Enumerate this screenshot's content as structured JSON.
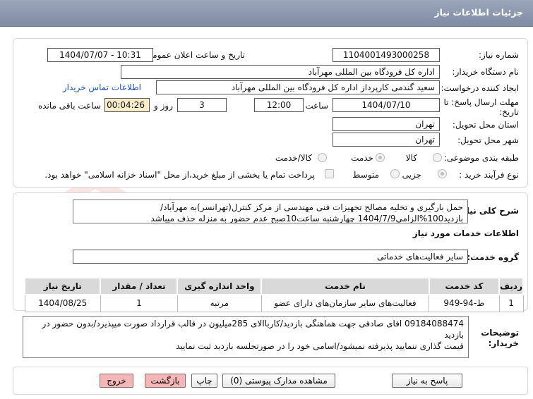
{
  "header": {
    "title": "جزئیات اطلاعات نیاز"
  },
  "form": {
    "need_number_label": "شماره نیاز:",
    "need_number": "1104001493000258",
    "announce_label": "تاریخ و ساعت اعلان عمومی:",
    "announce_value": "1404/07/07 - 10:31",
    "buyer_label": "نام دستگاه خریدار:",
    "buyer_value": "اداره کل فرودگاه بین المللی مهرآباد",
    "creator_label": "ایجاد کننده درخواست:",
    "creator_value": "سعید گندمی کارپرداز اداره کل فرودگاه بین المللی مهرآباد",
    "contact_link": "اطلاعات تماس خریدار",
    "deadline_label_1": "مهلت ارسال پاسخ: تا",
    "deadline_label_2": "تاریخ:",
    "deadline_date": "1404/07/10",
    "time_label": "ساعت",
    "deadline_time": "12:00",
    "days_value": "3",
    "days_label": "روز و",
    "timer_value": "00:04:26",
    "remaining_label": "ساعت باقی مانده",
    "province_label": "استان محل تحویل:",
    "province_value": "تهران",
    "city_label": "شهر محل تحویل:",
    "city_value": "تهران",
    "category_label": "طبقه بندی موضوعی:",
    "category_options": [
      "کالا",
      "خدمت",
      "کالا/خدمت"
    ],
    "process_label": "نوع فرآیند خرید :",
    "process_options": [
      "جزیی",
      "متوسط"
    ],
    "payment_note": "پرداخت تمام یا بخشی از مبلغ خرید،از محل \"اسناد خزانه اسلامی\" خواهد بود."
  },
  "summary": {
    "label": "شرح کلی نیاز:",
    "line1": "حمل بارگیری و تخلیه مصالح تجهیزات فنی مهندسی از مرکز کنترل(تهرانسر)به مهرآباد/",
    "line2": "بازدید100%الزامی1404/7/9 چهارشنبه ساعت10صبح عدم حضور به منزله حذف میباشد"
  },
  "services": {
    "section_title": "اطلاعات خدمات مورد نیاز",
    "group_label": "گروه خدمت:",
    "group_value": "سایر فعالیت‌های خدماتی",
    "columns": [
      "ردیف",
      "کد خدمت",
      "نام خدمت",
      "واحد اندازه گیری",
      "تعداد / مقدار",
      "تاریخ نیاز"
    ],
    "rows": [
      [
        "1",
        "ط-94-949",
        "فعالیت‌های سایر سازمان‌های دارای عضو",
        "مرتبه",
        "1",
        "1404/08/25"
      ]
    ]
  },
  "buyer_notes": {
    "label_1": "توضیحات",
    "label_2": "خریدار:",
    "line1": "09184088474 اقای صادقی جهت هماهنگی بازدید/کارباالای 285میلیون در قالب قرارداد صورت میپذیرد/بدون حضور در بازدید",
    "line2": "قیمت گذاری ننمایید پذیرفته نمیشود/اسامی خود را در صورتجلسه بازدید ثبت نمایید"
  },
  "buttons": {
    "reply": "پاسخ به نیاز",
    "attachments": "مشاهده مدارک پیوستی (0)",
    "print": "چاپ",
    "back": "بازگشت",
    "exit": "خروج"
  }
}
